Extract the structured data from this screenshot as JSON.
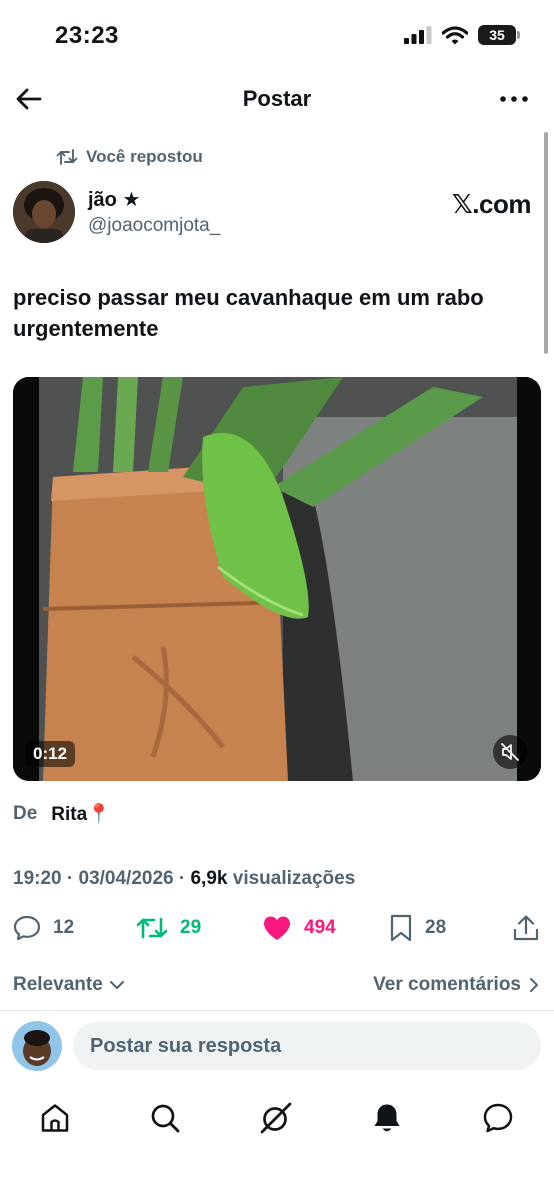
{
  "status_bar": {
    "time": "23:23",
    "battery": "35"
  },
  "header": {
    "title": "Postar"
  },
  "repost": {
    "label": "Você repostou"
  },
  "author": {
    "name": "jão ★",
    "handle": "@joaocomjota_",
    "source_badge": "𝕏.com"
  },
  "tweet": {
    "text": "preciso passar meu cavanhaque em um rabo urgentemente"
  },
  "media": {
    "duration": "0:12",
    "muted": true
  },
  "from": {
    "label": "De",
    "name": "Rita📍"
  },
  "meta": {
    "time": "19:20",
    "date": "03/04/2026",
    "views_count": "6,9k",
    "views_label": "visualizações"
  },
  "actions": {
    "replies": "12",
    "reposts": "29",
    "likes": "494",
    "bookmarks": "28",
    "reposted": true,
    "liked": true
  },
  "sort": {
    "label": "Relevante",
    "view_comments": "Ver comentários"
  },
  "reply": {
    "placeholder": "Postar sua resposta"
  },
  "tabs": [
    "home-icon",
    "search-icon",
    "grok-icon",
    "notifications-icon",
    "messages-icon"
  ],
  "colors": {
    "retweet": "#00ba7c",
    "like": "#f91880",
    "secondary": "#536471",
    "text": "#0f1419"
  }
}
